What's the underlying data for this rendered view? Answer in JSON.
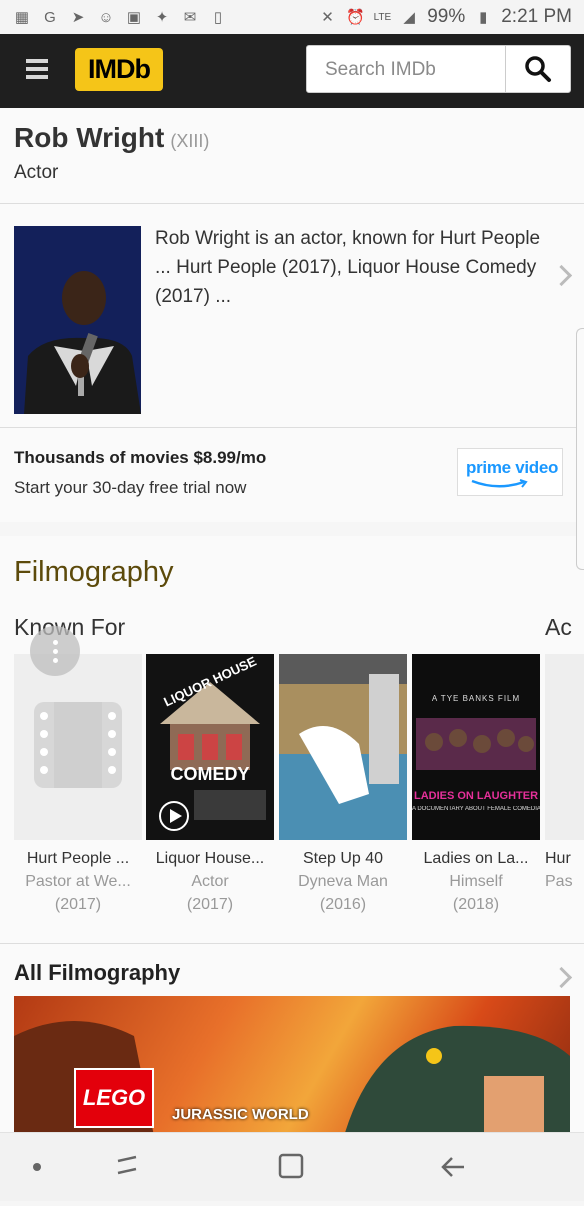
{
  "status_bar": {
    "battery": "99%",
    "time": "2:21 PM",
    "network": "LTE"
  },
  "app_bar": {
    "logo_text": "IMDb",
    "search_placeholder": "Search IMDb"
  },
  "person": {
    "name": "Rob Wright",
    "roman": "(XIII)",
    "role": "Actor",
    "bio": "Rob Wright is an actor, known for Hurt People ... Hurt People (2017), Liquor House Comedy (2017) ..."
  },
  "promo": {
    "title": "Thousands of movies $8.99/mo",
    "subtitle": "Start your 30-day free trial now",
    "badge": "prime video"
  },
  "filmography": {
    "heading": "Filmography",
    "known_for_label": "Known For",
    "next_section_label": "Ac",
    "items": [
      {
        "title": "Hurt People ...",
        "role": "Pastor at We...",
        "year": "(2017)"
      },
      {
        "title": "Liquor House...",
        "role": "Actor",
        "year": "(2017)"
      },
      {
        "title": "Step Up 40",
        "role": "Dyneva Man",
        "year": "(2016)"
      },
      {
        "title": "Ladies on La...",
        "role": "Himself",
        "year": "(2018)"
      },
      {
        "title": "Hur",
        "role": "Pas",
        "year": ""
      }
    ],
    "posters": {
      "liquor_top": "LIQUOR HOUSE",
      "liquor_bottom": "COMEDY",
      "ladies_top": "A TYE BANKS FILM",
      "ladies_main": "LADIES ON LAUGHTER",
      "ladies_sub": "A DOCUMENTARY ABOUT FEMALE COMEDIANS IN NC"
    }
  },
  "all_filmography": {
    "heading": "All Filmography",
    "banner_brand": "LEGO",
    "banner_title": "JURASSIC WORLD"
  },
  "colors": {
    "imdb_yellow": "#f5c518",
    "filmography_heading": "#5c4a0b",
    "prime_blue": "#1a98ff"
  }
}
